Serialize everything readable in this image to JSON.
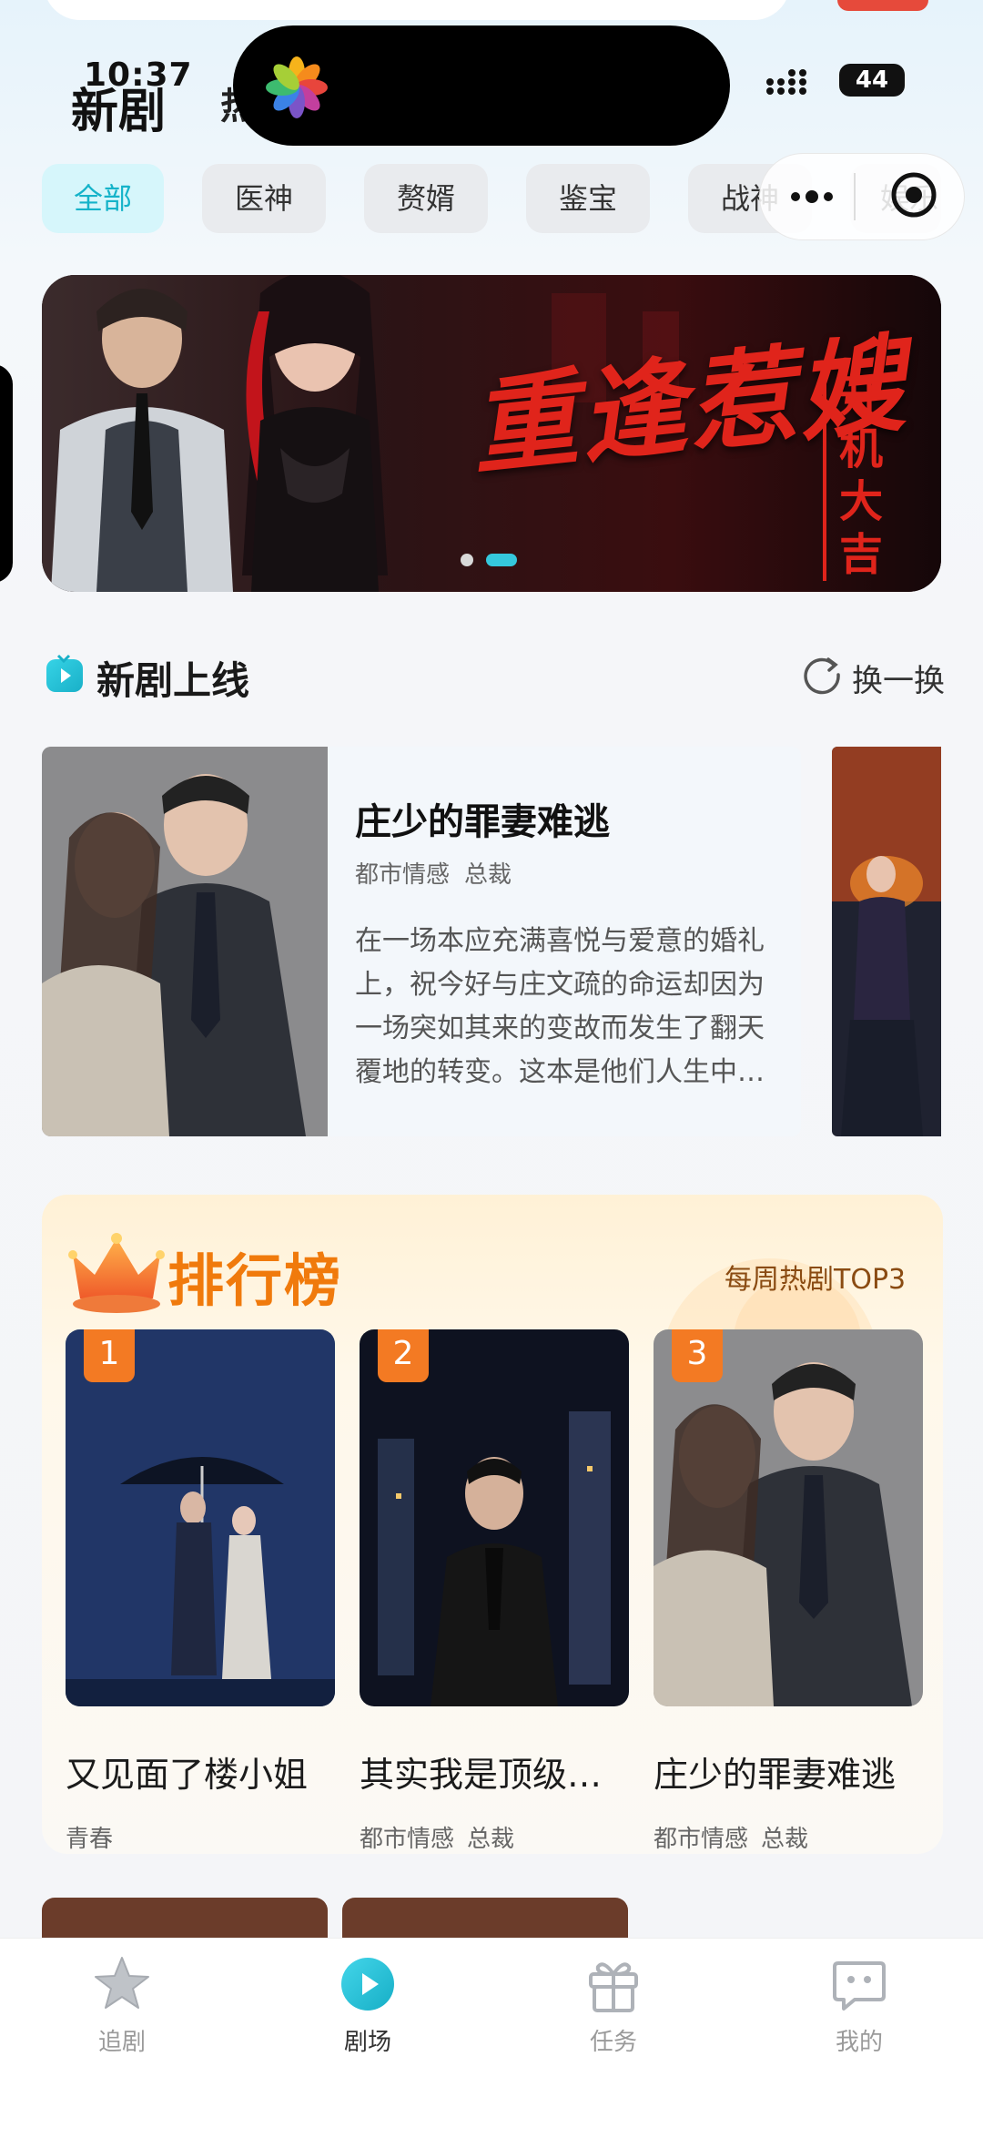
{
  "status_bar": {
    "time": "10:37",
    "battery": "44"
  },
  "header": {
    "title": "新剧",
    "hot_tab": "热"
  },
  "categories": [
    {
      "label": "全部",
      "active": true
    },
    {
      "label": "医神",
      "active": false
    },
    {
      "label": "赘婿",
      "active": false
    },
    {
      "label": "鉴宝",
      "active": false
    },
    {
      "label": "战神",
      "active": false
    },
    {
      "label": "娱乐",
      "active": false
    }
  ],
  "banner": {
    "title": "重逢惹嫂",
    "subtitle": "开机大吉",
    "active_slide": 2,
    "slide_count": 2
  },
  "new_drama": {
    "section_title": "新剧上线",
    "refresh_label": "换一换",
    "featured": {
      "name": "庄少的罪妻难逃",
      "tags": [
        "都市情感",
        "总裁"
      ],
      "description": "在一场本应充满喜悦与爱意的婚礼上，祝今好与庄文疏的命运却因为一场突如其来的变故而发生了翻天覆地的转变。这本是他们人生中最美好的时刻"
    }
  },
  "ranking": {
    "title": "排行榜",
    "subtitle": "每周热剧TOP3",
    "items": [
      {
        "rank": "1",
        "name": "又见面了楼小姐",
        "tags": [
          "青春"
        ]
      },
      {
        "rank": "2",
        "name": "其实我是顶级大佬",
        "tags": [
          "都市情感",
          "总裁"
        ]
      },
      {
        "rank": "3",
        "name": "庄少的罪妻难逃",
        "tags": [
          "都市情感",
          "总裁"
        ]
      }
    ]
  },
  "tab_bar": {
    "items": [
      {
        "label": "追剧",
        "icon": "star-icon",
        "active": false
      },
      {
        "label": "剧场",
        "icon": "play-icon",
        "active": true
      },
      {
        "label": "任务",
        "icon": "gift-icon",
        "active": false
      },
      {
        "label": "我的",
        "icon": "profile-icon",
        "active": false
      }
    ]
  },
  "colors": {
    "accent": "#15b3c9",
    "rank_orange": "#f37a23",
    "banner_red": "#e0241b"
  }
}
